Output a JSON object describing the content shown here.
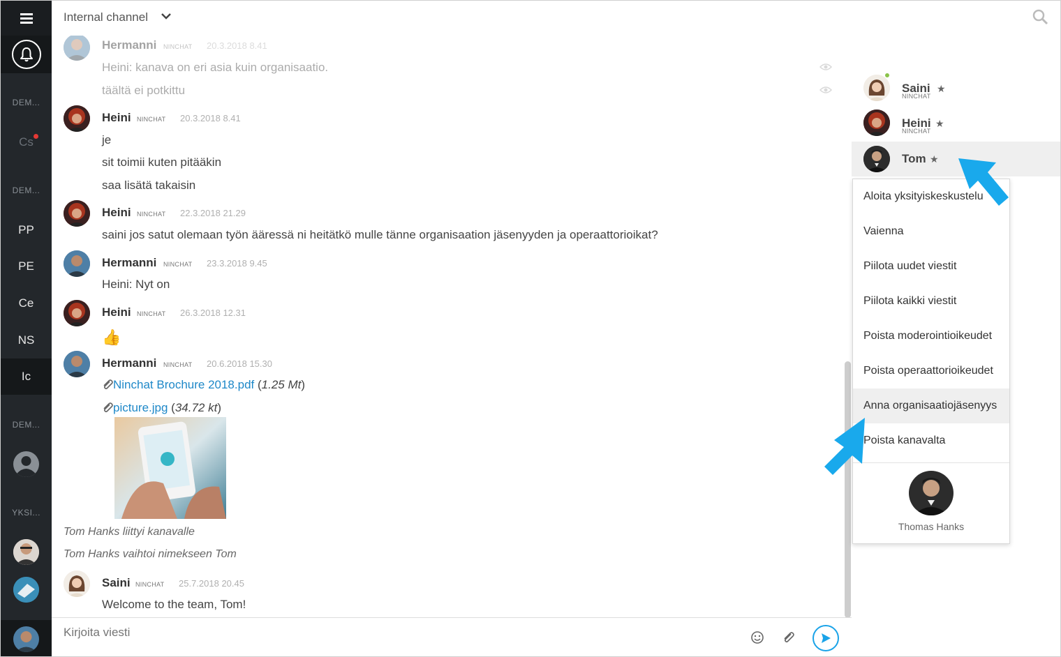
{
  "header": {
    "channel_title": "Internal channel"
  },
  "rail": {
    "section_labels": [
      "DEM...",
      "DEM...",
      "DEM...",
      "YKSI..."
    ],
    "channels": [
      {
        "label": "Cs",
        "unread": true
      },
      {
        "label": "PP"
      },
      {
        "label": "PE"
      },
      {
        "label": "Ce"
      },
      {
        "label": "NS"
      },
      {
        "label": "Ic",
        "active": true
      }
    ]
  },
  "messages": [
    {
      "author": "Hermanni",
      "org": "NINCHAT",
      "time": "20.3.2018 8.41",
      "lines": [
        "Heini: kanava on eri asia kuin organisaatio.",
        "täältä ei potkittu"
      ]
    },
    {
      "author": "Heini",
      "org": "NINCHAT",
      "time": "20.3.2018 8.41",
      "lines": [
        "je",
        "sit toimii kuten pitääkin",
        "saa lisätä takaisin"
      ]
    },
    {
      "author": "Heini",
      "org": "NINCHAT",
      "time": "22.3.2018 21.29",
      "lines": [
        "saini jos satut olemaan työn ääressä ni heitätkö mulle tänne organisaation jäsenyyden ja operaattorioikat?"
      ]
    },
    {
      "author": "Hermanni",
      "org": "NINCHAT",
      "time": "23.3.2018 9.45",
      "lines": [
        "Heini: Nyt on"
      ]
    },
    {
      "author": "Heini",
      "org": "NINCHAT",
      "time": "26.3.2018 12.31",
      "lines": [
        "👍"
      ]
    },
    {
      "author": "Hermanni",
      "org": "NINCHAT",
      "time": "20.6.2018 15.30",
      "files": [
        {
          "name": "Ninchat Brochure 2018.pdf",
          "size": "1.25 Mt"
        },
        {
          "name": "picture.jpg",
          "size": "34.72 kt"
        }
      ]
    },
    {
      "author": "Saini",
      "org": "NINCHAT",
      "time": "25.7.2018 20.45",
      "lines": [
        "Welcome to the team, Tom!"
      ]
    }
  ],
  "system_messages": [
    "Tom Hanks liittyi kanavalle",
    "Tom Hanks vaihtoi nimekseen Tom"
  ],
  "composer": {
    "placeholder": "Kirjoita viesti"
  },
  "members": [
    {
      "name": "Saini",
      "org": "NINCHAT",
      "online": true
    },
    {
      "name": "Heini",
      "org": "NINCHAT"
    },
    {
      "name": "Tom",
      "selected": true
    }
  ],
  "star": "★",
  "context_menu": {
    "items": [
      "Aloita yksityiskeskustelu",
      "Vaienna",
      "Piilota uudet viestit",
      "Piilota kaikki viestit",
      "Poista moderointioikeudet",
      "Poista operaattorioikeudet",
      "Anna organisaatiojäsenyys",
      "Poista kanavalta"
    ],
    "highlighted": "Anna organisaatiojäsenyys",
    "profile_name": "Thomas Hanks"
  },
  "colors": {
    "rail_bg": "#23272b",
    "link": "#1e88c8",
    "accent": "#1aa3e8",
    "online": "#8bc34a",
    "unread": "#e53935"
  }
}
